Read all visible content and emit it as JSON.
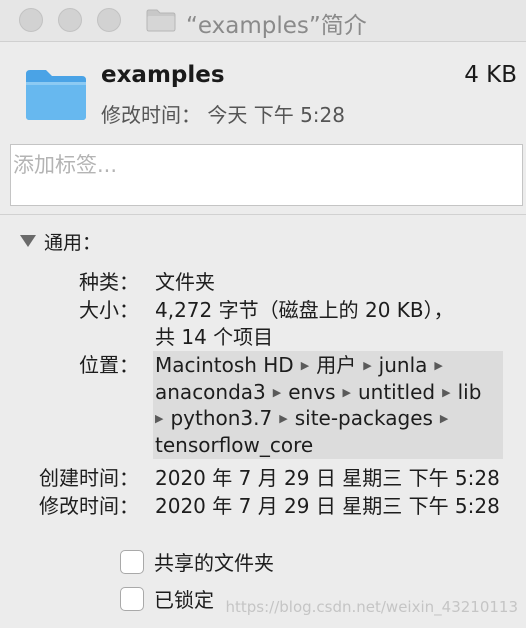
{
  "window": {
    "title": "“examples”简介",
    "folder_icon": "folder-icon"
  },
  "header": {
    "name": "examples",
    "size": "4 KB",
    "modified": "修改时间：  今天 下午 5:28"
  },
  "tags": {
    "placeholder": "添加标签..."
  },
  "general": {
    "section_label": "通用：",
    "kind_label": "种类：",
    "kind_value": "文件夹",
    "size_label": "大小：",
    "size_value_line1": "4,272 字节（磁盘上的 20 KB），",
    "size_value_line2": "共 14 个项目",
    "where_label": "位置：",
    "path": [
      "Macintosh HD",
      "用户",
      "junla",
      "anaconda3",
      "envs",
      "untitled",
      "lib",
      "python3.7",
      "site-packages",
      "tensorflow_core"
    ],
    "created_label": "创建时间：",
    "created_value": "2020 年 7 月 29 日 星期三 下午 5:28",
    "modified_label": "修改时间：",
    "modified_value": "2020 年 7 月 29 日 星期三 下午 5:28"
  },
  "options": {
    "shared_label": "共享的文件夹",
    "locked_label": "已锁定"
  },
  "watermark": "https://blog.csdn.net/weixin_43210113",
  "colors": {
    "folder_blue": "#67b8ef",
    "background": "#ececec"
  }
}
